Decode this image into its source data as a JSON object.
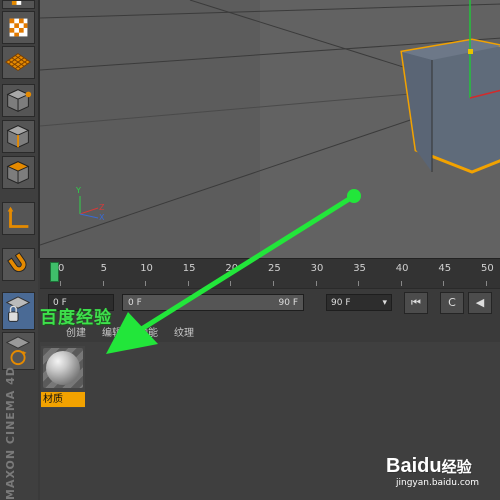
{
  "timeline": {
    "ticks": [
      "0",
      "5",
      "10",
      "15",
      "20",
      "25",
      "30",
      "35",
      "40",
      "45",
      "50"
    ]
  },
  "transport": {
    "start_field": "0 F",
    "range_start": "0 F",
    "range_end": "90 F",
    "end_field": "90 F",
    "dropdown_arrow": "▾",
    "btn_first": "⏮",
    "btn_c": "C",
    "btn_prev": "◀"
  },
  "material_manager": {
    "menu": [
      "创建",
      "编辑",
      "功能",
      "纹理"
    ],
    "materials": [
      {
        "name": "材质"
      }
    ]
  },
  "viewport": {
    "axis_y": "Y",
    "axis_z": "Z",
    "axis_x": "X"
  },
  "branding": {
    "app_vertical": "MAXON CINEMA 4D"
  },
  "watermarks": {
    "top_text": "百度经验",
    "bottom_logo": "Baidu",
    "bottom_logo_cn": "经验",
    "bottom_url": "jingyan.baidu.com"
  },
  "colors": {
    "selection_orange": "#f2a200",
    "annotation_green": "#22e63a",
    "timeline_playhead": "#3fbf6a"
  },
  "icons": [
    "checker-icon",
    "plane-grid-icon",
    "point-mode-icon",
    "edge-mode-icon",
    "polygon-mode-icon",
    "axis-icon",
    "magnet-icon",
    "layout-icon",
    "texture-mode-icon"
  ]
}
